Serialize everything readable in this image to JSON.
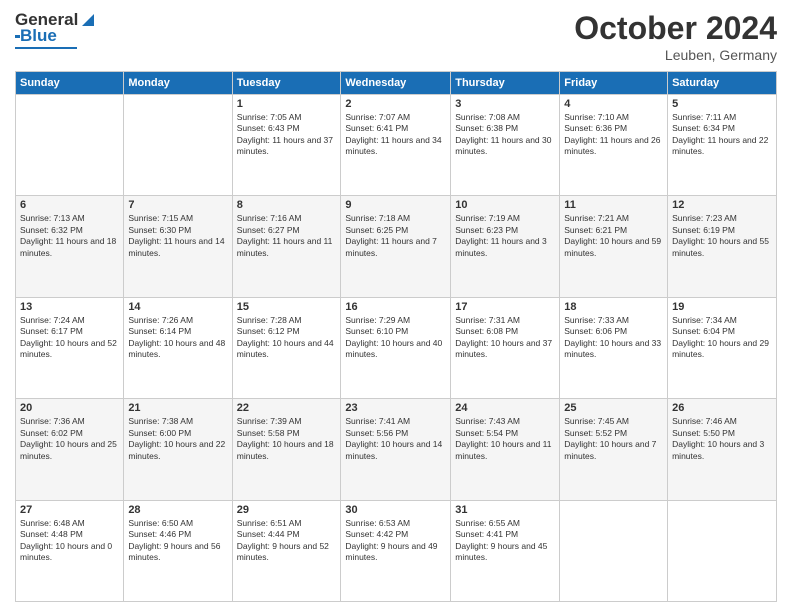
{
  "logo": {
    "line1": "General",
    "line2": "Blue"
  },
  "header": {
    "title": "October 2024",
    "subtitle": "Leuben, Germany"
  },
  "weekdays": [
    "Sunday",
    "Monday",
    "Tuesday",
    "Wednesday",
    "Thursday",
    "Friday",
    "Saturday"
  ],
  "weeks": [
    [
      {
        "day": "",
        "sunrise": "",
        "sunset": "",
        "daylight": ""
      },
      {
        "day": "",
        "sunrise": "",
        "sunset": "",
        "daylight": ""
      },
      {
        "day": "1",
        "sunrise": "Sunrise: 7:05 AM",
        "sunset": "Sunset: 6:43 PM",
        "daylight": "Daylight: 11 hours and 37 minutes."
      },
      {
        "day": "2",
        "sunrise": "Sunrise: 7:07 AM",
        "sunset": "Sunset: 6:41 PM",
        "daylight": "Daylight: 11 hours and 34 minutes."
      },
      {
        "day": "3",
        "sunrise": "Sunrise: 7:08 AM",
        "sunset": "Sunset: 6:38 PM",
        "daylight": "Daylight: 11 hours and 30 minutes."
      },
      {
        "day": "4",
        "sunrise": "Sunrise: 7:10 AM",
        "sunset": "Sunset: 6:36 PM",
        "daylight": "Daylight: 11 hours and 26 minutes."
      },
      {
        "day": "5",
        "sunrise": "Sunrise: 7:11 AM",
        "sunset": "Sunset: 6:34 PM",
        "daylight": "Daylight: 11 hours and 22 minutes."
      }
    ],
    [
      {
        "day": "6",
        "sunrise": "Sunrise: 7:13 AM",
        "sunset": "Sunset: 6:32 PM",
        "daylight": "Daylight: 11 hours and 18 minutes."
      },
      {
        "day": "7",
        "sunrise": "Sunrise: 7:15 AM",
        "sunset": "Sunset: 6:30 PM",
        "daylight": "Daylight: 11 hours and 14 minutes."
      },
      {
        "day": "8",
        "sunrise": "Sunrise: 7:16 AM",
        "sunset": "Sunset: 6:27 PM",
        "daylight": "Daylight: 11 hours and 11 minutes."
      },
      {
        "day": "9",
        "sunrise": "Sunrise: 7:18 AM",
        "sunset": "Sunset: 6:25 PM",
        "daylight": "Daylight: 11 hours and 7 minutes."
      },
      {
        "day": "10",
        "sunrise": "Sunrise: 7:19 AM",
        "sunset": "Sunset: 6:23 PM",
        "daylight": "Daylight: 11 hours and 3 minutes."
      },
      {
        "day": "11",
        "sunrise": "Sunrise: 7:21 AM",
        "sunset": "Sunset: 6:21 PM",
        "daylight": "Daylight: 10 hours and 59 minutes."
      },
      {
        "day": "12",
        "sunrise": "Sunrise: 7:23 AM",
        "sunset": "Sunset: 6:19 PM",
        "daylight": "Daylight: 10 hours and 55 minutes."
      }
    ],
    [
      {
        "day": "13",
        "sunrise": "Sunrise: 7:24 AM",
        "sunset": "Sunset: 6:17 PM",
        "daylight": "Daylight: 10 hours and 52 minutes."
      },
      {
        "day": "14",
        "sunrise": "Sunrise: 7:26 AM",
        "sunset": "Sunset: 6:14 PM",
        "daylight": "Daylight: 10 hours and 48 minutes."
      },
      {
        "day": "15",
        "sunrise": "Sunrise: 7:28 AM",
        "sunset": "Sunset: 6:12 PM",
        "daylight": "Daylight: 10 hours and 44 minutes."
      },
      {
        "day": "16",
        "sunrise": "Sunrise: 7:29 AM",
        "sunset": "Sunset: 6:10 PM",
        "daylight": "Daylight: 10 hours and 40 minutes."
      },
      {
        "day": "17",
        "sunrise": "Sunrise: 7:31 AM",
        "sunset": "Sunset: 6:08 PM",
        "daylight": "Daylight: 10 hours and 37 minutes."
      },
      {
        "day": "18",
        "sunrise": "Sunrise: 7:33 AM",
        "sunset": "Sunset: 6:06 PM",
        "daylight": "Daylight: 10 hours and 33 minutes."
      },
      {
        "day": "19",
        "sunrise": "Sunrise: 7:34 AM",
        "sunset": "Sunset: 6:04 PM",
        "daylight": "Daylight: 10 hours and 29 minutes."
      }
    ],
    [
      {
        "day": "20",
        "sunrise": "Sunrise: 7:36 AM",
        "sunset": "Sunset: 6:02 PM",
        "daylight": "Daylight: 10 hours and 25 minutes."
      },
      {
        "day": "21",
        "sunrise": "Sunrise: 7:38 AM",
        "sunset": "Sunset: 6:00 PM",
        "daylight": "Daylight: 10 hours and 22 minutes."
      },
      {
        "day": "22",
        "sunrise": "Sunrise: 7:39 AM",
        "sunset": "Sunset: 5:58 PM",
        "daylight": "Daylight: 10 hours and 18 minutes."
      },
      {
        "day": "23",
        "sunrise": "Sunrise: 7:41 AM",
        "sunset": "Sunset: 5:56 PM",
        "daylight": "Daylight: 10 hours and 14 minutes."
      },
      {
        "day": "24",
        "sunrise": "Sunrise: 7:43 AM",
        "sunset": "Sunset: 5:54 PM",
        "daylight": "Daylight: 10 hours and 11 minutes."
      },
      {
        "day": "25",
        "sunrise": "Sunrise: 7:45 AM",
        "sunset": "Sunset: 5:52 PM",
        "daylight": "Daylight: 10 hours and 7 minutes."
      },
      {
        "day": "26",
        "sunrise": "Sunrise: 7:46 AM",
        "sunset": "Sunset: 5:50 PM",
        "daylight": "Daylight: 10 hours and 3 minutes."
      }
    ],
    [
      {
        "day": "27",
        "sunrise": "Sunrise: 6:48 AM",
        "sunset": "Sunset: 4:48 PM",
        "daylight": "Daylight: 10 hours and 0 minutes."
      },
      {
        "day": "28",
        "sunrise": "Sunrise: 6:50 AM",
        "sunset": "Sunset: 4:46 PM",
        "daylight": "Daylight: 9 hours and 56 minutes."
      },
      {
        "day": "29",
        "sunrise": "Sunrise: 6:51 AM",
        "sunset": "Sunset: 4:44 PM",
        "daylight": "Daylight: 9 hours and 52 minutes."
      },
      {
        "day": "30",
        "sunrise": "Sunrise: 6:53 AM",
        "sunset": "Sunset: 4:42 PM",
        "daylight": "Daylight: 9 hours and 49 minutes."
      },
      {
        "day": "31",
        "sunrise": "Sunrise: 6:55 AM",
        "sunset": "Sunset: 4:41 PM",
        "daylight": "Daylight: 9 hours and 45 minutes."
      },
      {
        "day": "",
        "sunrise": "",
        "sunset": "",
        "daylight": ""
      },
      {
        "day": "",
        "sunrise": "",
        "sunset": "",
        "daylight": ""
      }
    ]
  ]
}
